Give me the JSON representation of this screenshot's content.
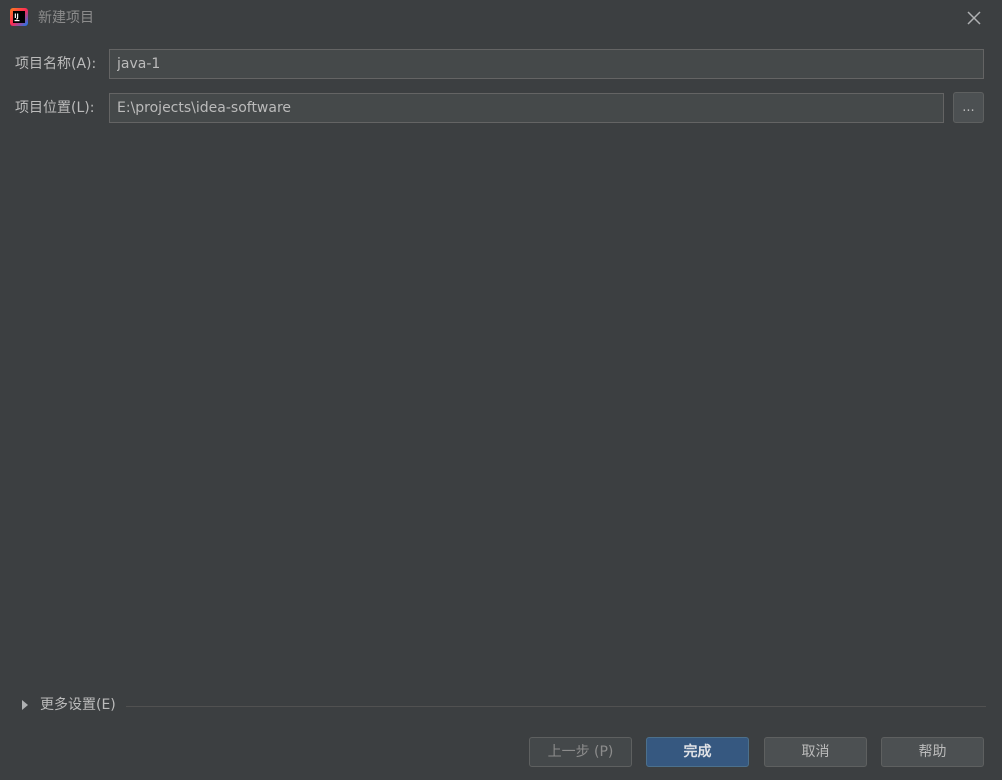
{
  "window": {
    "title": "新建项目",
    "icon": "intellij-idea-icon",
    "close_icon": "close-icon"
  },
  "form": {
    "name_label": "项目名称(A):",
    "name_value": "java-1",
    "location_label": "项目位置(L):",
    "location_value": "E:\\projects\\idea-software",
    "browse_label": "..."
  },
  "more_settings": {
    "label": "更多设置(E)",
    "expanded": false
  },
  "buttons": {
    "previous": "上一步 (P)",
    "finish": "完成",
    "cancel": "取消",
    "help": "帮助"
  },
  "colors": {
    "background": "#3c3f41",
    "input_background": "#45494a",
    "primary_button": "#365880",
    "text": "#bbbbbb"
  }
}
